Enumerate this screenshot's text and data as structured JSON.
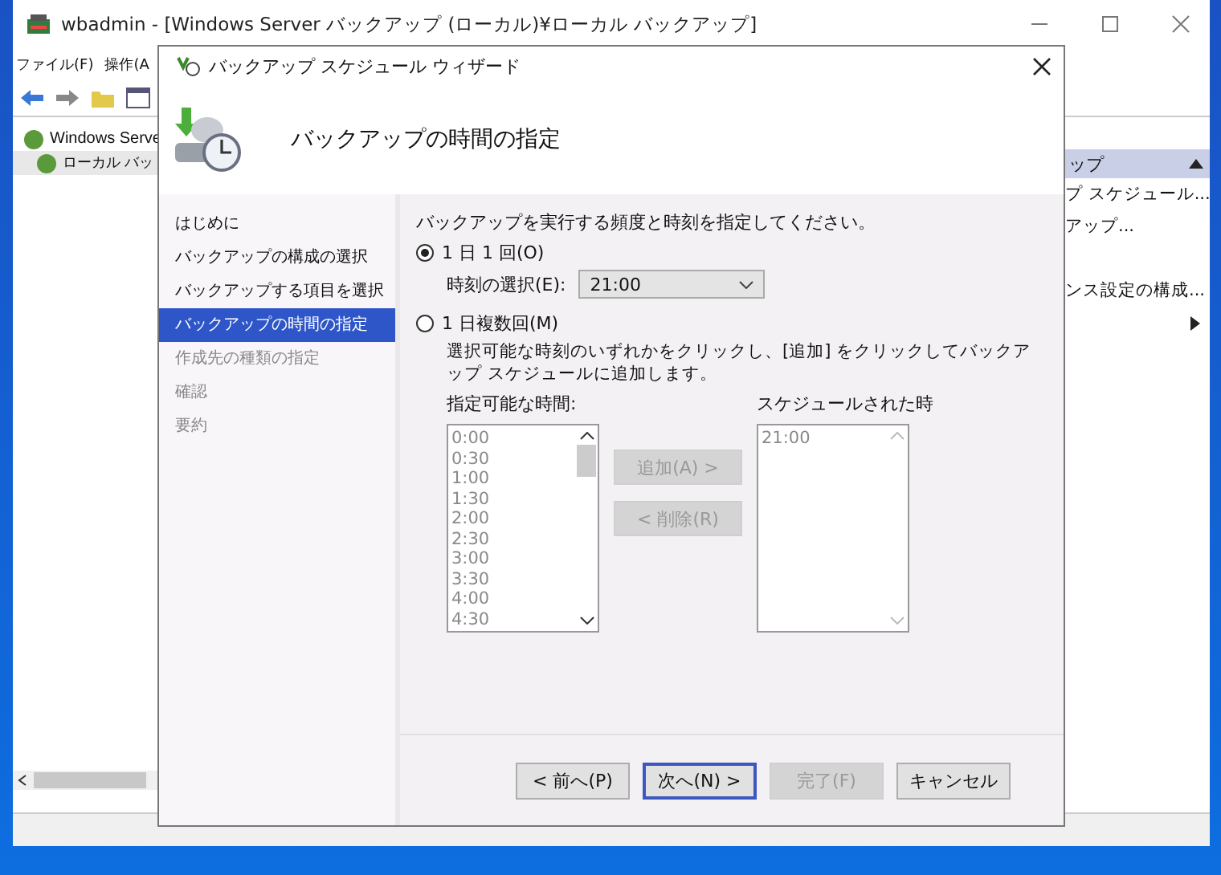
{
  "main_window": {
    "title": "wbadmin - [Windows Server バックアップ (ローカル)¥ローカル バックアップ]",
    "menu": [
      "ファイル(F)",
      "操作(A"
    ],
    "tree": [
      {
        "label": "Windows Serve",
        "children": [
          {
            "label": "ローカル バッ"
          }
        ]
      }
    ],
    "actions_header": "ップ",
    "actions": [
      "プ スケジュール...",
      "アップ...",
      "ンス設定の構成..."
    ]
  },
  "dialog": {
    "title": "バックアップ スケジュール ウィザード",
    "heading": "バックアップの時間の指定",
    "steps": [
      {
        "label": "はじめに",
        "selected": false,
        "disabled": false
      },
      {
        "label": "バックアップの構成の選択",
        "selected": false,
        "disabled": false
      },
      {
        "label": "バックアップする項目を選択",
        "selected": false,
        "disabled": false
      },
      {
        "label": "バックアップの時間の指定",
        "selected": true,
        "disabled": false
      },
      {
        "label": "作成先の種類の指定",
        "selected": false,
        "disabled": true
      },
      {
        "label": "確認",
        "selected": false,
        "disabled": true
      },
      {
        "label": "要約",
        "selected": false,
        "disabled": true
      }
    ],
    "instruction": "バックアップを実行する頻度と時刻を指定してください。",
    "options": [
      {
        "label": "1 日 1 回(O)",
        "selected": true
      },
      {
        "label": "1 日複数回(M)",
        "selected": false
      }
    ],
    "time_label": "時刻の選択(E):",
    "time_value": "21:00",
    "multi_note": "選択可能な時刻のいずれかをクリックし、[追加] をクリックしてバックアップ スケジュールに追加します。",
    "available_label": "指定可能な時間:",
    "available_times": [
      "0:00",
      "0:30",
      "1:00",
      "1:30",
      "2:00",
      "2:30",
      "3:00",
      "3:30",
      "4:00",
      "4:30"
    ],
    "scheduled_label": "スケジュールされた時",
    "scheduled_times": [
      "21:00"
    ],
    "list_buttons": [
      {
        "label": "追加(A) >",
        "disabled": true
      },
      {
        "label": "< 削除(R)",
        "disabled": true
      }
    ],
    "footer_buttons": [
      {
        "label": "< 前へ(P)",
        "disabled": false,
        "default": false
      },
      {
        "label": "次へ(N) >",
        "disabled": false,
        "default": true
      },
      {
        "label": "完了(F)",
        "disabled": true,
        "default": false
      },
      {
        "label": "キャンセル",
        "disabled": false,
        "default": false
      }
    ]
  }
}
